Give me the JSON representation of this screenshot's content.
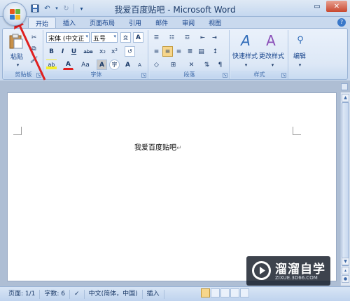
{
  "window": {
    "title": "我爱百度贴吧 - Microsoft Word",
    "minimize_icon": "minimize-icon",
    "close_icon": "close-icon"
  },
  "quick_access": {
    "save_icon": "save-icon",
    "undo_icon": "undo-icon",
    "redo_icon": "redo-icon",
    "customize_icon": "dropdown-icon"
  },
  "tabs": [
    "开始",
    "插入",
    "页面布局",
    "引用",
    "邮件",
    "审阅",
    "视图"
  ],
  "ribbon": {
    "clipboard": {
      "label": "剪贴板",
      "paste_label": "粘贴"
    },
    "font": {
      "label": "字体",
      "font_name": "宋体 (中文正",
      "font_size": "五号",
      "wen_button": "wén",
      "grow_font": "A",
      "shrink_font": "A",
      "bold": "B",
      "italic": "I",
      "underline": "U",
      "strike": "abe",
      "subscript": "x₂",
      "superscript": "x²",
      "clear_format": "Aa",
      "char_border": "A",
      "char_shading": "A",
      "enclose": "字",
      "font_color": "A",
      "highlight": "ab"
    },
    "paragraph": {
      "label": "段落"
    },
    "styles": {
      "label": "样式",
      "quick_styles_label": "快速样式",
      "change_styles_label": "更改样式"
    },
    "editing": {
      "label": "编辑"
    }
  },
  "document": {
    "text": "我爱百度贴吧",
    "paragraph_mark": "↵"
  },
  "statusbar": {
    "page": "页面: 1/1",
    "words": "字数: 6",
    "language": "中文(简体，中国)",
    "mode": "插入"
  },
  "watermark": {
    "title": "溜溜自学",
    "url": "ZIXUE.3D66.COM"
  },
  "colors": {
    "accent": "#15428b",
    "annotation_arrow": "#e02020",
    "close_button": "#c8472f"
  }
}
